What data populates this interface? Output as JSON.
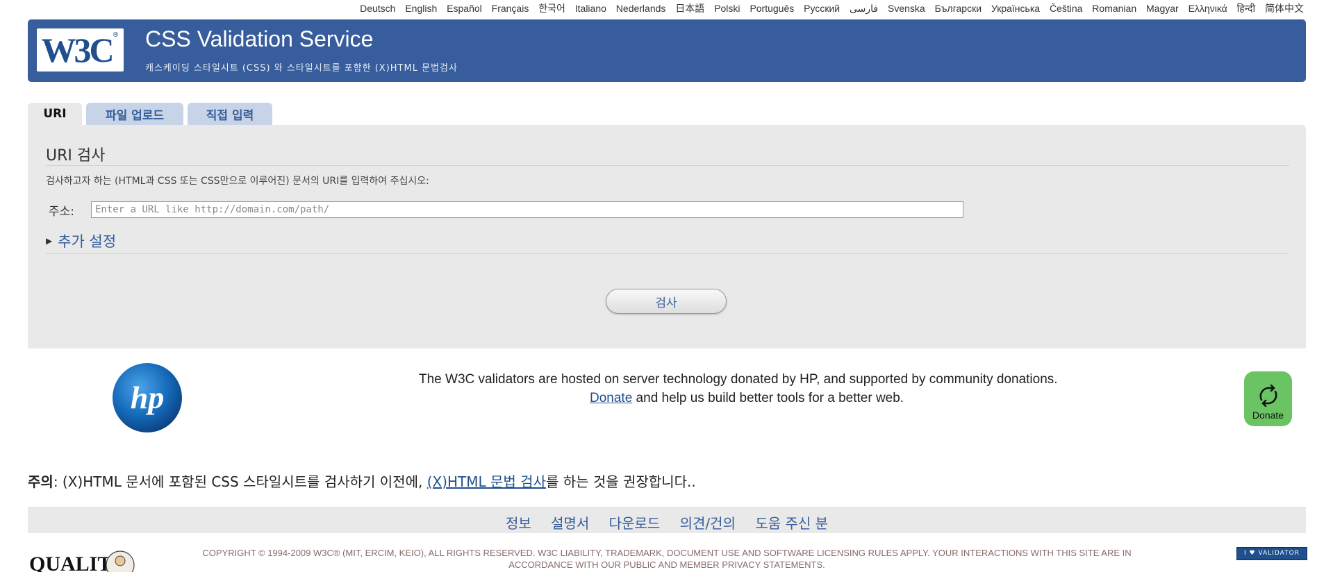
{
  "languages": [
    "Deutsch",
    "English",
    "Español",
    "Français",
    "한국어",
    "Italiano",
    "Nederlands",
    "日本語",
    "Polski",
    "Português",
    "Русский",
    "فارسی",
    "Svenska",
    "Български",
    "Українська",
    "Čeština",
    "Romanian",
    "Magyar",
    "Ελληνικά",
    "हिन्दी",
    "简体中文"
  ],
  "banner": {
    "logo_text": "W3C",
    "logo_mark": "®",
    "title": "CSS Validation Service",
    "subtitle": "캐스케이딩 스타일시트 (CSS) 와 스타일시트를 포함한 (X)HTML 문법검사"
  },
  "tabs": [
    {
      "label": "URI",
      "active": true
    },
    {
      "label": "파일 업로드",
      "active": false
    },
    {
      "label": "직접 입력",
      "active": false
    }
  ],
  "panel": {
    "title": "URI 검사",
    "description": "검사하고자 하는 (HTML과 CSS 또는 CSS만으로 이루어진) 문서의 URI를 입력하여 주십시오:",
    "address_label": "주소:",
    "address_placeholder": "Enter a URL like http://domain.com/path/",
    "address_value": "",
    "more_settings": "추가 설정",
    "check_button": "검사"
  },
  "sponsor": {
    "logo_text": "hp",
    "line1": "The W3C validators are hosted on server technology donated by HP, and supported by community donations.",
    "donate_link": "Donate",
    "line2_rest": " and help us build better tools for a better web.",
    "donate_badge": "Donate"
  },
  "note": {
    "label": "주의",
    "text_before": ": (X)HTML 문서에 포함된 CSS 스타일시트를 검사하기 이전에, ",
    "link": "(X)HTML 문법 검사",
    "text_after": "를 하는 것을 권장합니다.."
  },
  "footer_nav": [
    "정보",
    "설명서",
    "다운로드",
    "의견/건의",
    "도움 주신 분"
  ],
  "copyright": "COPYRIGHT © 1994-2009 W3C® (MIT, ERCIM, KEIO), ALL RIGHTS RESERVED. W3C LIABILITY, TRADEMARK, DOCUMENT USE AND SOFTWARE LICENSING RULES APPLY. YOUR INTERACTIONS WITH THIS SITE ARE IN ACCORDANCE WITH OUR PUBLIC AND MEMBER PRIVACY STATEMENTS.",
  "quality_logo_text": "QUALITY",
  "validator_badge": "I ♥ VALIDATOR",
  "colors": {
    "banner": "#375d9c",
    "panel": "#e9e9e9",
    "tab_inactive": "#c7d3e6",
    "donate_green": "#6bc464",
    "link": "#1f4f8c"
  }
}
